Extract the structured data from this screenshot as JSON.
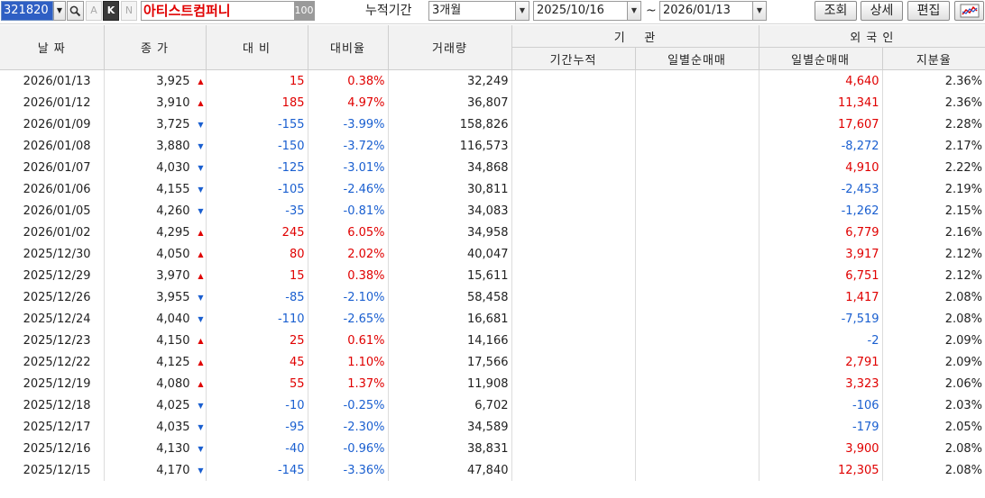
{
  "toolbar": {
    "code": "321820",
    "search_icon": "magnifier-icon",
    "btn_a": "A",
    "btn_k": "K",
    "btn_n": "N",
    "company": "아티스트컴퍼니",
    "company_tag": "100",
    "period_label": "누적기간",
    "period_value": "3개월",
    "date_from": "2025/10/16",
    "tilde": "~",
    "date_to": "2026/01/13",
    "query_btn": "조회",
    "detail_btn": "상세",
    "edit_btn": "편집",
    "chart_icon": "chart-icon"
  },
  "headers": {
    "date": "날 짜",
    "close": "종 가",
    "change": "대 비",
    "rate": "대비율",
    "volume": "거래량",
    "inst_group": "기    관",
    "inst_cum": "기간누적",
    "inst_daily": "일별순매매",
    "foreign_group": "외 국 인",
    "foreign_daily": "일별순매매",
    "foreign_share": "지분율"
  },
  "colors": {
    "up": "#e00000",
    "down": "#1a5fd0"
  },
  "rows": [
    {
      "date": "2026/01/13",
      "close": "3,925",
      "dir": "up",
      "change": "15",
      "rate": "0.38%",
      "volume": "32,249",
      "fdaily": "4,640",
      "fshare": "2.36%"
    },
    {
      "date": "2026/01/12",
      "close": "3,910",
      "dir": "up",
      "change": "185",
      "rate": "4.97%",
      "volume": "36,807",
      "fdaily": "11,341",
      "fshare": "2.36%"
    },
    {
      "date": "2026/01/09",
      "close": "3,725",
      "dir": "down",
      "change": "-155",
      "rate": "-3.99%",
      "volume": "158,826",
      "fdaily": "17,607",
      "fshare": "2.28%"
    },
    {
      "date": "2026/01/08",
      "close": "3,880",
      "dir": "down",
      "change": "-150",
      "rate": "-3.72%",
      "volume": "116,573",
      "fdaily": "-8,272",
      "fshare": "2.17%"
    },
    {
      "date": "2026/01/07",
      "close": "4,030",
      "dir": "down",
      "change": "-125",
      "rate": "-3.01%",
      "volume": "34,868",
      "fdaily": "4,910",
      "fshare": "2.22%"
    },
    {
      "date": "2026/01/06",
      "close": "4,155",
      "dir": "down",
      "change": "-105",
      "rate": "-2.46%",
      "volume": "30,811",
      "fdaily": "-2,453",
      "fshare": "2.19%"
    },
    {
      "date": "2026/01/05",
      "close": "4,260",
      "dir": "down",
      "change": "-35",
      "rate": "-0.81%",
      "volume": "34,083",
      "fdaily": "-1,262",
      "fshare": "2.15%"
    },
    {
      "date": "2026/01/02",
      "close": "4,295",
      "dir": "up",
      "change": "245",
      "rate": "6.05%",
      "volume": "34,958",
      "fdaily": "6,779",
      "fshare": "2.16%"
    },
    {
      "date": "2025/12/30",
      "close": "4,050",
      "dir": "up",
      "change": "80",
      "rate": "2.02%",
      "volume": "40,047",
      "fdaily": "3,917",
      "fshare": "2.12%"
    },
    {
      "date": "2025/12/29",
      "close": "3,970",
      "dir": "up",
      "change": "15",
      "rate": "0.38%",
      "volume": "15,611",
      "fdaily": "6,751",
      "fshare": "2.12%"
    },
    {
      "date": "2025/12/26",
      "close": "3,955",
      "dir": "down",
      "change": "-85",
      "rate": "-2.10%",
      "volume": "58,458",
      "fdaily": "1,417",
      "fshare": "2.08%"
    },
    {
      "date": "2025/12/24",
      "close": "4,040",
      "dir": "down",
      "change": "-110",
      "rate": "-2.65%",
      "volume": "16,681",
      "fdaily": "-7,519",
      "fshare": "2.08%"
    },
    {
      "date": "2025/12/23",
      "close": "4,150",
      "dir": "up",
      "change": "25",
      "rate": "0.61%",
      "volume": "14,166",
      "fdaily": "-2",
      "fshare": "2.09%"
    },
    {
      "date": "2025/12/22",
      "close": "4,125",
      "dir": "up",
      "change": "45",
      "rate": "1.10%",
      "volume": "17,566",
      "fdaily": "2,791",
      "fshare": "2.09%"
    },
    {
      "date": "2025/12/19",
      "close": "4,080",
      "dir": "up",
      "change": "55",
      "rate": "1.37%",
      "volume": "11,908",
      "fdaily": "3,323",
      "fshare": "2.06%"
    },
    {
      "date": "2025/12/18",
      "close": "4,025",
      "dir": "down",
      "change": "-10",
      "rate": "-0.25%",
      "volume": "6,702",
      "fdaily": "-106",
      "fshare": "2.03%"
    },
    {
      "date": "2025/12/17",
      "close": "4,035",
      "dir": "down",
      "change": "-95",
      "rate": "-2.30%",
      "volume": "34,589",
      "fdaily": "-179",
      "fshare": "2.05%"
    },
    {
      "date": "2025/12/16",
      "close": "4,130",
      "dir": "down",
      "change": "-40",
      "rate": "-0.96%",
      "volume": "38,831",
      "fdaily": "3,900",
      "fshare": "2.08%"
    },
    {
      "date": "2025/12/15",
      "close": "4,170",
      "dir": "down",
      "change": "-145",
      "rate": "-3.36%",
      "volume": "47,840",
      "fdaily": "12,305",
      "fshare": "2.08%"
    }
  ]
}
